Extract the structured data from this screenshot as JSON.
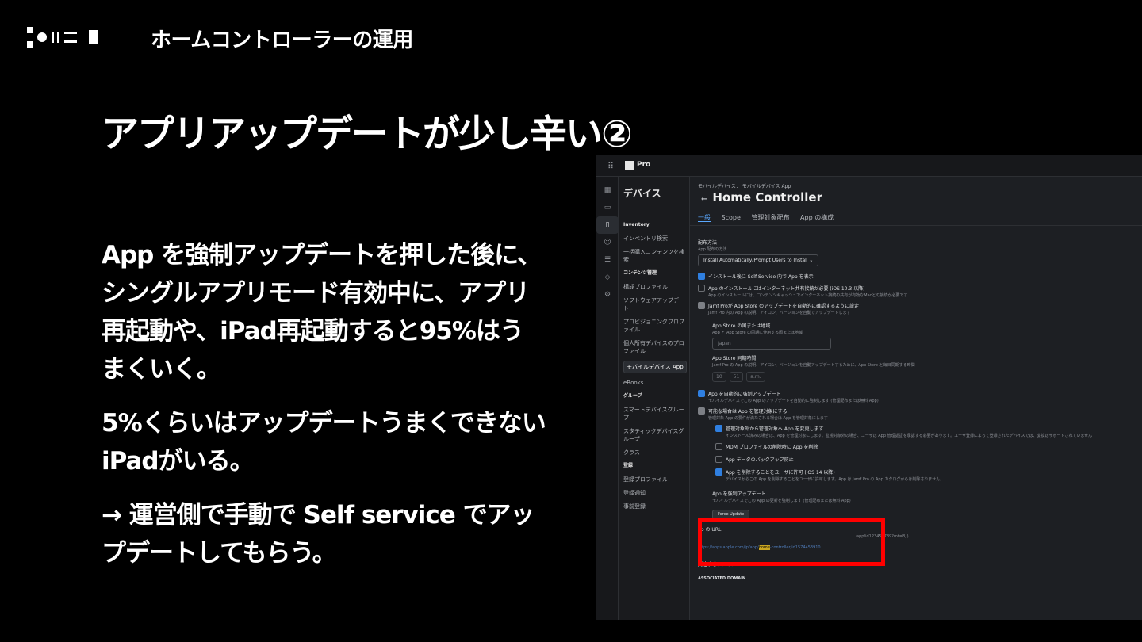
{
  "header": {
    "title": "ホームコントローラーの運用"
  },
  "slide": {
    "title": "アプリアップデートが少し辛い②",
    "paragraphs": [
      "App を強制アップデートを押した後に、シングルアプリモード有効中に、アプリ再起動や、iPad再起動すると95%はうまくいく。",
      "5%くらいはアップデートうまくできないiPadがいる。",
      "→ 運営側で手動で Self service でアップデートしてもらう。"
    ]
  },
  "screenshot": {
    "product": "Pro",
    "nav": {
      "heading": "デバイス",
      "items": [
        "Inventory",
        "インベントリ検索",
        "一括購入コンテンツを検索",
        "コンテンツ管理",
        "構成プロファイル",
        "ソフトウェアアップデート",
        "プロビジョニングプロファイル",
        "個人所有デバイスのプロファイル",
        "モバイルデバイス App",
        "eBooks",
        "グループ",
        "スマートデバイスグループ",
        "スタティックデバイスグループ",
        "クラス",
        "登録",
        "登録プロファイル",
        "登録通知",
        "事前登録"
      ]
    },
    "breadcrumb": "モバイルデバイス： モバイルデバイス App",
    "title": "Home Controller",
    "tabs": [
      "一般",
      "Scope",
      "管理対象配布",
      "App の構成"
    ],
    "distribution_label": "配布方法",
    "distribution_sub": "App 配布の方法",
    "distribution_value": "Install Automatically/Prompt Users to Install",
    "options": [
      {
        "label": "インストール後に Self Service 内で App を表示",
        "sub": ""
      },
      {
        "label": "App のインストールにはインターネット共有接続が必要 (iOS 10.3 以降)",
        "sub": "App のインストールには、コンテンツキャッシュでインターネット接続の共有が有効なMacとの接続が必要です"
      },
      {
        "label": "Jamf Proが App Store のアップデートを自動的に確認するように設定",
        "sub": "Jamf Pro 内の App の説明、アイコン、バージョンを自動でアップデートします"
      }
    ],
    "region_label": "App Store の国または地域",
    "region_sub": "App と App Store の同期に使用する国または地域",
    "region_value": "Japan",
    "sync_label": "App Store 同期時間",
    "sync_sub": "Jamf Pro の App の説明、アイコン、バージョンを自動アップデートするために、App Store と毎日同期する時間",
    "sync_hour": "10",
    "sync_min": "51",
    "sync_ampm": "a.m.",
    "options2": [
      {
        "label": "App を自動的に強制アップデート",
        "sub": "モバイルデバイスでこの App のアップデートを自動的に強制します (管理配布または無料 App)"
      },
      {
        "label": "可能な場合は App を管理対象にする",
        "sub": "管理対象 App の要件が満たされる場合は App を管理対象にします"
      },
      {
        "label": "管理対象外から管理対象へ App を変更します",
        "sub": "インストール済みの場合は、App を管理対象にします。監視対象外の場合、ユーザは App 管理認証を承認する必要があります。ユーザ登録によって登録されたデバイスでは、変換はサポートされていません"
      },
      {
        "label": "MDM プロファイルの削除時に App を削除",
        "sub": ""
      },
      {
        "label": "App データのバックアップ防止",
        "sub": ""
      },
      {
        "label": "App を削除することをユーザに許可 (iOS 14 以降)",
        "sub": "デバイスからこの App を削除することをユーザに許可します。App は Jamf Pro の App カタログからは削除されません。"
      }
    ],
    "force_label": "App を強制アップデート",
    "force_sub": "モバイルデバイスでこの App の更新を強制します (管理配布または無料 App)",
    "force_button": "Force Update",
    "url_label": "pp の URL",
    "url_partial": "app/id123456789?mt=8」)",
    "url_pre": "https://apps.apple.com/jp/app/",
    "url_hl": "home",
    "url_post": "-controller/id1574453910",
    "domain_label": "関連するドメイン",
    "domain_sub": "ASSOCIATED DOMAIN"
  }
}
